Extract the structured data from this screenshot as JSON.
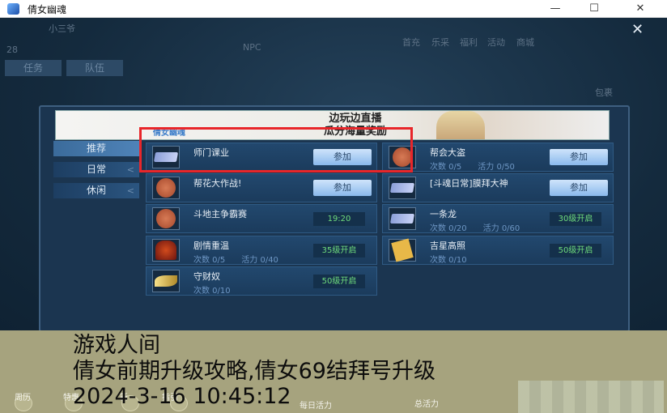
{
  "window": {
    "title": "倩女幽魂",
    "minimize": "—",
    "maximize": "☐",
    "close": "✕"
  },
  "hud": {
    "player_name": "小三爷",
    "level": "28",
    "npc_label": "NPC",
    "task_tab": "任务",
    "team_tab": "队伍",
    "menu": [
      "首充",
      "乐采",
      "福利",
      "活动",
      "商城"
    ],
    "bag": "包裹"
  },
  "panel": {
    "close": "✕",
    "banner": {
      "line1": "边玩边直播",
      "line2": "瓜分海量奖励",
      "logo": "倩女幽魂"
    },
    "tabs": [
      {
        "label": "推荐",
        "active": true
      },
      {
        "label": "日常",
        "active": false
      },
      {
        "label": "休闲",
        "active": false
      }
    ],
    "activities": [
      {
        "name": "师门课业",
        "icon": "ticket-icon",
        "action": "参加",
        "stats": []
      },
      {
        "name": "帮会大盗",
        "icon": "coin-icon",
        "action": "参加",
        "stats": [
          "次数 0/5",
          "活力 0/50"
        ]
      },
      {
        "name": "帮花大作战!",
        "icon": "coin-icon",
        "action": "参加",
        "stats": []
      },
      {
        "name": "[斗魂日常]膜拜大神",
        "icon": "ticket-icon",
        "action": "参加",
        "stats": []
      },
      {
        "name": "斗地主争霸赛",
        "icon": "coin-icon",
        "status": "19:20",
        "stats": []
      },
      {
        "name": "一条龙",
        "icon": "ticket-icon",
        "status": "30级开启",
        "stats": [
          "次数 0/20",
          "活力 0/60"
        ]
      },
      {
        "name": "剧情重温",
        "icon": "helmet-icon",
        "status": "35级开启",
        "stats": [
          "次数 0/5",
          "活力 0/40"
        ]
      },
      {
        "name": "吉星高照",
        "icon": "book-icon",
        "status": "50级开启",
        "stats": [
          "次数 0/10"
        ]
      },
      {
        "name": "守财奴",
        "icon": "leaf-icon",
        "status": "50级开启",
        "stats": [
          "次数 0/10"
        ]
      }
    ]
  },
  "overlay": {
    "line1": "游戏人间",
    "line2": "倩女前期升级攻略,倩女69结拜号升级",
    "line3": "2024-3-16 10:45:12"
  },
  "bottom_hud": {
    "labels": [
      "周历",
      "特惠",
      "新",
      "指引"
    ],
    "daily": "每日活力",
    "total": "总活力"
  },
  "colors": {
    "highlight": "#e8262a",
    "status_green": "#6fdc7c",
    "overlay_bg": "#a6a37e"
  }
}
